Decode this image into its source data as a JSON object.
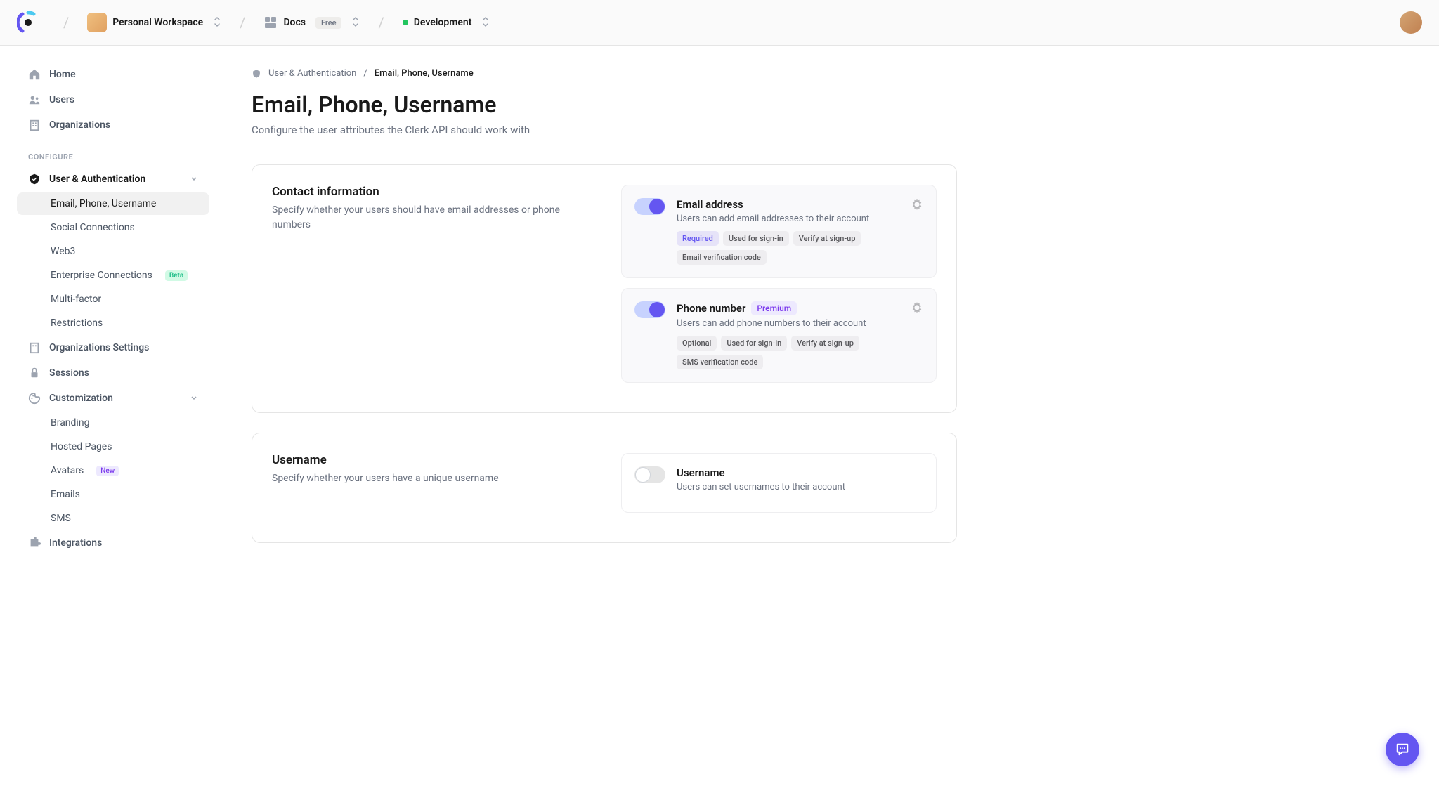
{
  "header": {
    "workspace": "Personal Workspace",
    "app": "Docs",
    "app_plan": "Free",
    "environment": "Development"
  },
  "sidebar": {
    "top_items": [
      {
        "label": "Home"
      },
      {
        "label": "Users"
      },
      {
        "label": "Organizations"
      }
    ],
    "configure_label": "CONFIGURE",
    "user_auth": {
      "label": "User & Authentication",
      "children": [
        {
          "label": "Email, Phone, Username",
          "active": true
        },
        {
          "label": "Social Connections"
        },
        {
          "label": "Web3"
        },
        {
          "label": "Enterprise Connections",
          "badge": "Beta"
        },
        {
          "label": "Multi-factor"
        },
        {
          "label": "Restrictions"
        }
      ]
    },
    "org_settings": "Organizations Settings",
    "sessions": "Sessions",
    "customization": {
      "label": "Customization",
      "children": [
        {
          "label": "Branding"
        },
        {
          "label": "Hosted Pages"
        },
        {
          "label": "Avatars",
          "badge": "New"
        },
        {
          "label": "Emails"
        },
        {
          "label": "SMS"
        }
      ]
    },
    "integrations": "Integrations"
  },
  "breadcrumb": {
    "parent": "User & Authentication",
    "sep": "/",
    "current": "Email, Phone, Username"
  },
  "page": {
    "title": "Email, Phone, Username",
    "subtitle": "Configure the user attributes the Clerk API should work with"
  },
  "contact_section": {
    "title": "Contact information",
    "desc": "Specify whether your users should have email addresses or phone numbers",
    "email": {
      "title": "Email address",
      "desc": "Users can add email addresses to their account",
      "tags": [
        "Required",
        "Used for sign-in",
        "Verify at sign-up",
        "Email verification code"
      ]
    },
    "phone": {
      "title": "Phone number",
      "premium": "Premium",
      "desc": "Users can add phone numbers to their account",
      "tags": [
        "Optional",
        "Used for sign-in",
        "Verify at sign-up",
        "SMS verification code"
      ]
    }
  },
  "username_section": {
    "title": "Username",
    "desc": "Specify whether your users have a unique username",
    "option": {
      "title": "Username",
      "desc": "Users can set usernames to their account"
    }
  }
}
